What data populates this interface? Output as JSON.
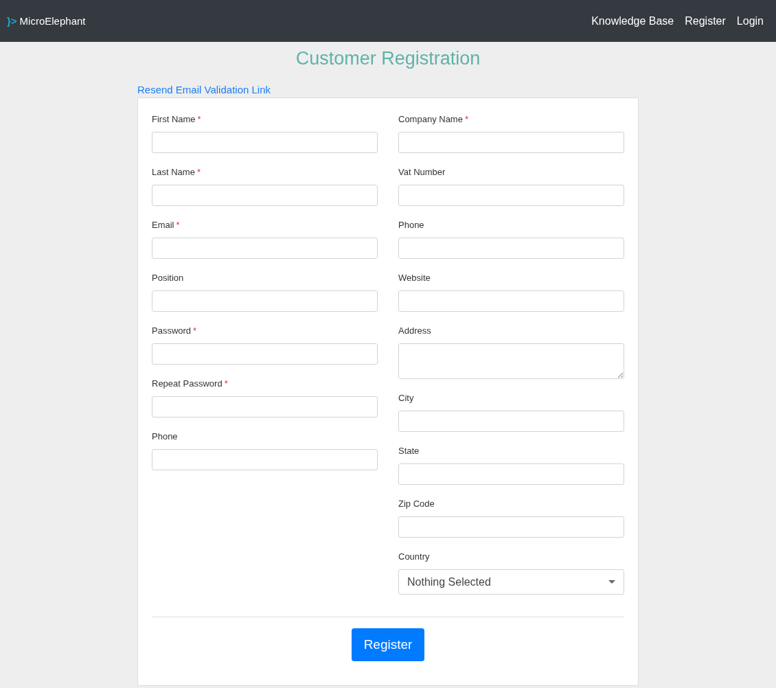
{
  "navbar": {
    "logo_mark": "}>",
    "brand": "MicroElephant",
    "links": [
      "Knowledge Base",
      "Register",
      "Login"
    ]
  },
  "title": "Customer Registration",
  "resend_link": "Resend Email Validation Link",
  "form": {
    "columns": [
      [
        {
          "kind": "input",
          "label": "First Name",
          "required_mark": "*"
        },
        {
          "kind": "input",
          "label": "Last Name",
          "required_mark": "*"
        },
        {
          "kind": "input",
          "label": "Email",
          "required_mark": "*"
        },
        {
          "kind": "input",
          "label": "Position"
        },
        {
          "kind": "input",
          "label": "Password",
          "required_mark": "*"
        },
        {
          "kind": "input",
          "label": "Repeat Password",
          "required_mark": "*"
        },
        {
          "kind": "input",
          "label": "Phone"
        }
      ],
      [
        {
          "kind": "input",
          "label": "Company Name",
          "required_mark": "*"
        },
        {
          "kind": "input",
          "label": "Vat Number"
        },
        {
          "kind": "input",
          "label": "Phone"
        },
        {
          "kind": "input",
          "label": "Website"
        },
        {
          "kind": "textarea",
          "label": "Address"
        },
        {
          "kind": "input",
          "label": "City"
        },
        {
          "kind": "input",
          "label": "State"
        },
        {
          "kind": "input",
          "label": "Zip Code"
        },
        {
          "kind": "select",
          "label": "Country",
          "value": "Nothing Selected"
        }
      ]
    ],
    "submit": "Register"
  }
}
